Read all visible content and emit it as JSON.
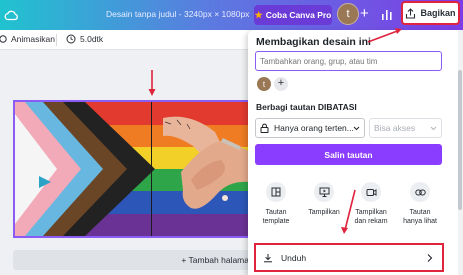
{
  "topbar": {
    "doc_title": "Desain tanpa judul - 3240px × 1080px",
    "pro_label": "Coba Canva Pro",
    "avatar_initial": "t",
    "share_label": "Bagikan"
  },
  "toolbar": {
    "animate_label": "Animasikan",
    "duration_label": "5.0dtk"
  },
  "canvas": {
    "add_page_label": "+ Tambah halama"
  },
  "share_panel": {
    "title": "Membagikan desain ini",
    "input_placeholder": "Tambahkan orang, grup, atau tim",
    "avatar_initial": "t",
    "link_heading": "Berbagi tautan DIBATASI",
    "access_select": "Hanya orang terten...",
    "permission_select": "Bisa akses",
    "copy_link_label": "Salin tautan",
    "options": [
      {
        "label": "Tautan template",
        "icon": "template-icon"
      },
      {
        "label": "Tampilkan",
        "icon": "present-icon"
      },
      {
        "label": "Tampilkan dan rekam",
        "icon": "record-icon"
      },
      {
        "label": "Tautan hanya lihat",
        "icon": "link-icon"
      }
    ],
    "download_label": "Unduh"
  },
  "colors": {
    "accent_purple": "#8b3dff",
    "highlight_red": "#e0243d",
    "topbar_start": "#20c3cf",
    "topbar_end": "#7d3ce6"
  }
}
